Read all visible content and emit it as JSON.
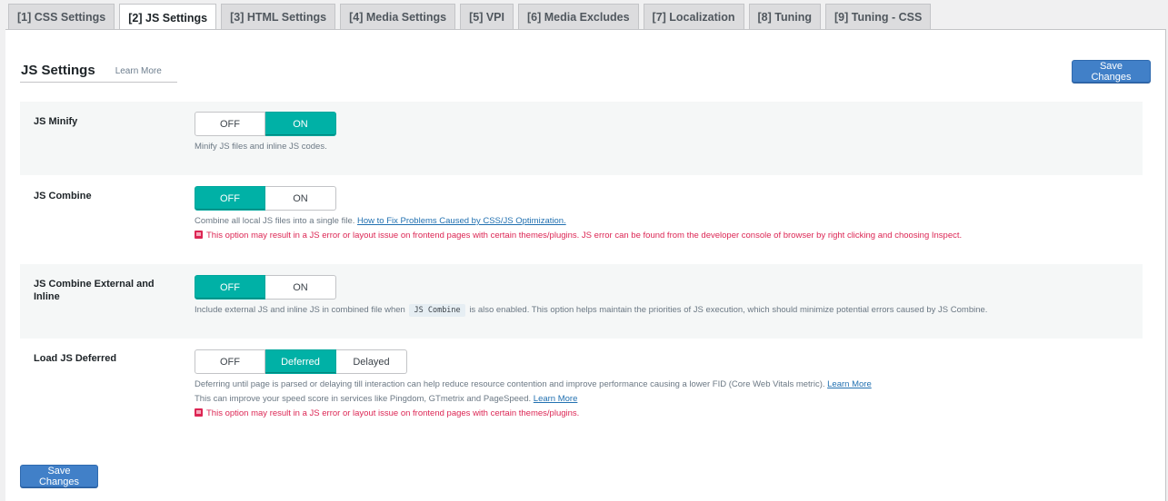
{
  "tabs": [
    {
      "label": "[1] CSS Settings",
      "active": false
    },
    {
      "label": "[2] JS Settings",
      "active": true
    },
    {
      "label": "[3] HTML Settings",
      "active": false
    },
    {
      "label": "[4] Media Settings",
      "active": false
    },
    {
      "label": "[5] VPI",
      "active": false
    },
    {
      "label": "[6] Media Excludes",
      "active": false
    },
    {
      "label": "[7] Localization",
      "active": false
    },
    {
      "label": "[8] Tuning",
      "active": false
    },
    {
      "label": "[9] Tuning - CSS",
      "active": false
    }
  ],
  "header": {
    "title": "JS Settings",
    "learn_more": "Learn More",
    "save_label": "Save Changes"
  },
  "settings": [
    {
      "label": "JS Minify",
      "options": [
        "OFF",
        "ON"
      ],
      "selected": "ON",
      "description": "Minify JS files and inline JS codes."
    },
    {
      "label": "JS Combine",
      "options": [
        "OFF",
        "ON"
      ],
      "selected": "OFF",
      "description": "Combine all local JS files into a single file.",
      "link": "How to Fix Problems Caused by CSS/JS Optimization.",
      "warning": "This option may result in a JS error or layout issue on frontend pages with certain themes/plugins. JS error can be found from the developer console of browser by right clicking and choosing Inspect."
    },
    {
      "label": "JS Combine External and Inline",
      "options": [
        "OFF",
        "ON"
      ],
      "selected": "OFF",
      "description_before": "Include external JS and inline JS in combined file when",
      "code": "JS Combine",
      "description_after": "is also enabled. This option helps maintain the priorities of JS execution, which should minimize potential errors caused by JS Combine."
    },
    {
      "label": "Load JS Deferred",
      "options": [
        "OFF",
        "Deferred",
        "Delayed"
      ],
      "selected": "Deferred",
      "description": "Deferring until page is parsed or delaying till interaction can help reduce resource contention and improve performance causing a lower FID (Core Web Vitals metric).",
      "link": "Learn More",
      "description2": "This can improve your speed score in services like Pingdom, GTmetrix and PageSpeed.",
      "link2": "Learn More",
      "warning": "This option may result in a JS error or layout issue on frontend pages with certain themes/plugins."
    }
  ],
  "footer": {
    "save_label": "Save Changes"
  },
  "colors": {
    "toggle_active": "#00b1a6",
    "save_button": "#4180c8",
    "warning": "#dc2654",
    "link": "#2271b1"
  }
}
